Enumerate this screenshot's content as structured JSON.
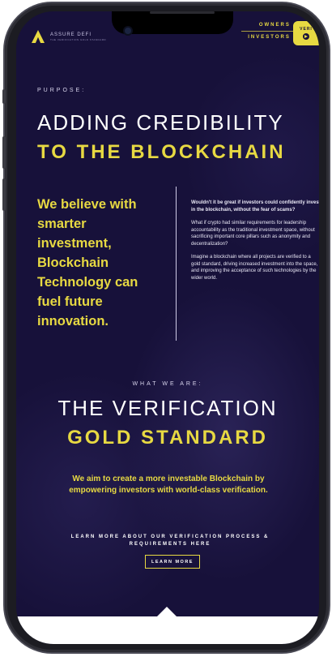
{
  "header": {
    "logo_text": "ASSURE DEFI",
    "logo_tagline": "THE VERIFICATION GOLD STANDARD",
    "nav": [
      {
        "label": "OWNERS +"
      },
      {
        "label": "INVESTORS +"
      }
    ],
    "verify_tab": "VERI"
  },
  "purpose": {
    "eyebrow": "PURPOSE:",
    "heading_light": "ADDING CREDIBILITY",
    "heading_bold": "TO THE BLOCKCHAIN",
    "belief": "We believe with smarter investment, Blockchain Technology can fuel future innovation.",
    "right_lead": "Wouldn't it be great if investors could confidently invest in the blockchain, without the fear of scams?",
    "right_p1": "What if crypto had similar requirements for leadership accountability as the traditional investment space, without sacrificing important core pillars such as anonymity and decentralization?",
    "right_p2": "Imagine a blockchain where all projects are verified to a gold standard, driving increased investment into the space, and improving the acceptance of such technologies by the wider world."
  },
  "what_we_are": {
    "eyebrow": "WHAT WE ARE:",
    "heading_light": "THE VERIFICATION",
    "heading_bold": "GOLD STANDARD",
    "aim": "We aim to create a more investable Blockchain by empowering investors with world-class verification.",
    "learn_link": "LEARN MORE ABOUT OUR VERIFICATION PROCESS & REQUIREMENTS HERE",
    "learn_button": "LEARN MORE"
  },
  "colors": {
    "background": "#17113a",
    "accent": "#e7d942",
    "text": "#ffffff"
  }
}
